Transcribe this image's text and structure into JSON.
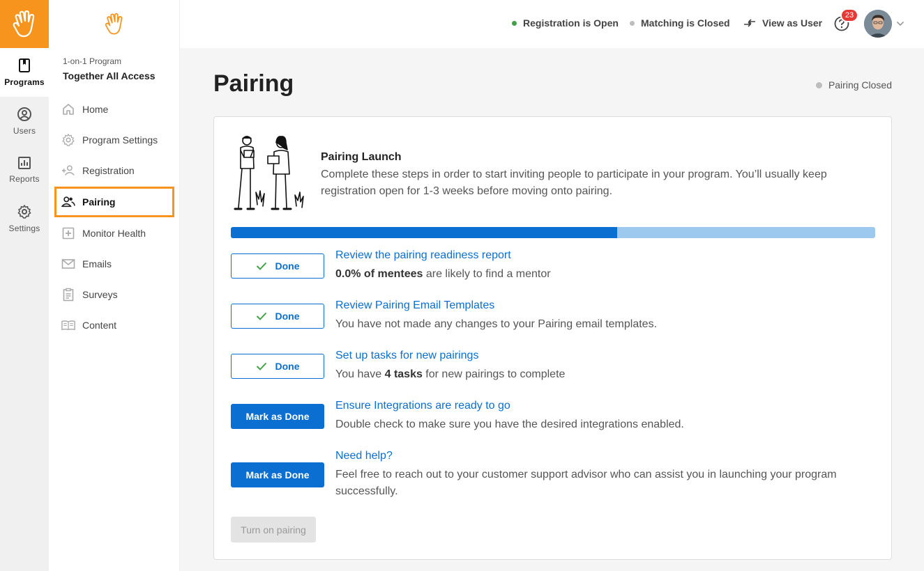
{
  "rail": {
    "items": [
      {
        "label": "Programs",
        "icon": "bookmark-icon"
      },
      {
        "label": "Users",
        "icon": "user-circle-icon"
      },
      {
        "label": "Reports",
        "icon": "bar-chart-icon"
      },
      {
        "label": "Settings",
        "icon": "gear-icon"
      }
    ]
  },
  "sidebar": {
    "program_type": "1-on-1 Program",
    "program_name": "Together All Access",
    "items": [
      {
        "label": "Home",
        "icon": "home-icon"
      },
      {
        "label": "Program Settings",
        "icon": "gear-icon"
      },
      {
        "label": "Registration",
        "icon": "add-user-icon"
      },
      {
        "label": "Pairing",
        "icon": "users-icon"
      },
      {
        "label": "Monitor Health",
        "icon": "health-cross-icon"
      },
      {
        "label": "Emails",
        "icon": "mail-icon"
      },
      {
        "label": "Surveys",
        "icon": "clipboard-icon"
      },
      {
        "label": "Content",
        "icon": "book-icon"
      }
    ]
  },
  "topbar": {
    "registration_status": "Registration is Open",
    "matching_status": "Matching is Closed",
    "view_as_user": "View as User",
    "notification_count": "23"
  },
  "colors": {
    "brand": "#f7941d",
    "primary": "#0a6fd0",
    "progress_track": "#9ec9ef",
    "status_open": "#43a047",
    "status_closed": "#bdbdbd"
  },
  "main": {
    "title": "Pairing",
    "pairing_status": "Pairing Closed",
    "launch_title": "Pairing Launch",
    "launch_desc": "Complete these steps in order to start inviting people to participate in your program. You’ll usually keep registration open for 1-3 weeks before moving onto pairing.",
    "progress_fraction": 0.6,
    "done_label": "Done",
    "mark_label": "Mark as Done",
    "steps": [
      {
        "title": "Review the pairing readiness report",
        "desc_bold": "0.0% of mentees",
        "desc_rest": " are likely to find a mentor",
        "done": true
      },
      {
        "title": "Review Pairing Email Templates",
        "desc_pre": "You have not made any changes to your Pairing email templates.",
        "done": true
      },
      {
        "title": "Set up tasks for new pairings",
        "desc_pre": "You have ",
        "desc_bold": "4 tasks",
        "desc_rest": " for new pairings to complete",
        "done": true
      },
      {
        "title": "Ensure Integrations are ready to go",
        "desc_pre": "Double check to make sure you have the desired integrations enabled.",
        "done": false
      },
      {
        "title": "Need help?",
        "desc_pre": "Feel free to reach out to your customer support advisor who can assist you in launching your program successfully.",
        "done": false
      }
    ],
    "turn_on_label": "Turn on pairing"
  }
}
